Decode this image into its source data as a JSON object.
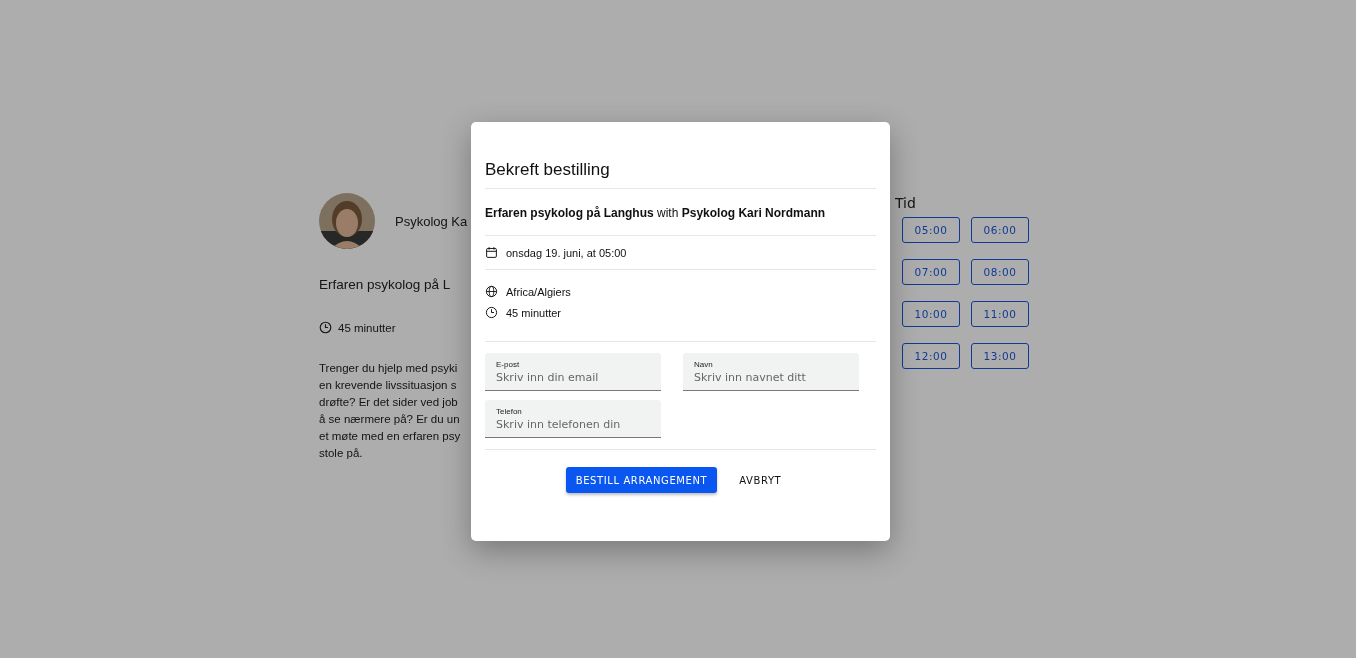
{
  "page": {
    "host_name": "Psykolog Ka",
    "event_title": "Erfaren psykolog på L",
    "duration": "45 minutter",
    "description_lines": [
      "Trenger du hjelp med psyki",
      "en krevende livssituasjon s",
      "drøfte? Er det sider ved job",
      "å se nærmere på? Er du un",
      "et møte med en erfaren psy",
      "stole på."
    ],
    "time_heading": "Tid",
    "time_slots": [
      "05:00",
      "06:00",
      "07:00",
      "08:00",
      "10:00",
      "11:00",
      "12:00",
      "13:00"
    ]
  },
  "dialog": {
    "title": "Bekreft bestilling",
    "event": "**Erfaren psykolog på Langhus** with **Psykolog Kari Nordmann**",
    "date": "onsdag 19. juni, at 05:00",
    "timezone": "Africa/Algiers",
    "duration": "45 minutter",
    "fields": [
      {
        "label": "E-post",
        "placeholder": "Skriv inn din email"
      },
      {
        "label": "Navn",
        "placeholder": "Skriv inn navnet ditt"
      },
      {
        "label": "Telefon",
        "placeholder": "Skriv inn telefonen din"
      }
    ],
    "buttons": [
      {
        "label": "BESTILL ARRANGEMENT",
        "kind": "primary"
      },
      {
        "label": "AVBRYT",
        "kind": "text"
      }
    ]
  }
}
